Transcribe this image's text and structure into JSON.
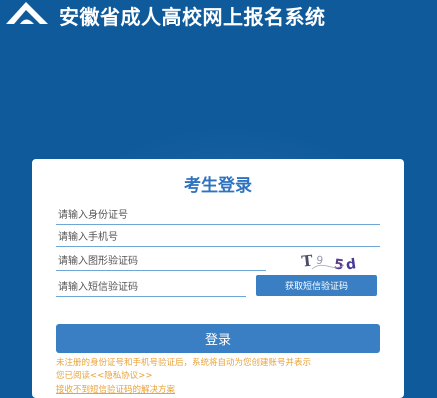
{
  "header": {
    "title": "安徽省成人高校网上报名系统",
    "logo_icon": "school-emblem-icon"
  },
  "login": {
    "title": "考生登录",
    "id_placeholder": "请输入身份证号",
    "phone_placeholder": "请输入手机号",
    "captcha_placeholder": "请输入图形验证码",
    "sms_placeholder": "请输入短信验证码",
    "captcha_text": "T⁹ 5d",
    "sms_button": "获取短信验证码",
    "login_button": "登录",
    "notice_text": "未注册的身份证号和手机号验证后，系统将自动为您创建账号并表示",
    "notice_agreed": "您已阅读",
    "privacy_link": "<<隐私协议>>",
    "help_link": "接收不到短信验证码的解决方案"
  },
  "colors": {
    "background": "#0f5a9a",
    "accent": "#3a7fc4",
    "title_blue": "#2f73c0",
    "notice": "#e9a23b"
  }
}
